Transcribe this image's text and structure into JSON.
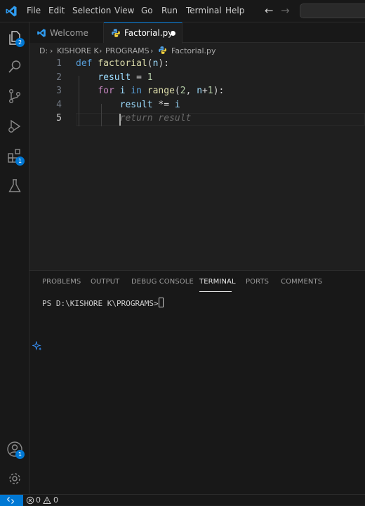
{
  "menu": [
    "File",
    "Edit",
    "Selection",
    "View",
    "Go",
    "Run",
    "Terminal",
    "Help"
  ],
  "activity": {
    "explorer_badge": "2",
    "extensions_badge": "1",
    "accounts_badge": "1"
  },
  "tabs": [
    {
      "label": "Welcome"
    },
    {
      "label": "Factorial.py",
      "modified": true
    }
  ],
  "breadcrumb": {
    "drive": "D:",
    "folder1": "KISHORE K",
    "folder2": "PROGRAMS",
    "file": "Factorial.py"
  },
  "editor": {
    "lines": [
      {
        "num": "1",
        "tokens": [
          [
            "kw",
            "def "
          ],
          [
            "fn",
            "factorial"
          ],
          [
            "txt",
            "("
          ],
          [
            "var",
            "n"
          ],
          [
            "txt",
            "):"
          ]
        ]
      },
      {
        "num": "2",
        "tokens": [
          [
            "txt",
            "    "
          ],
          [
            "var",
            "result"
          ],
          [
            "txt",
            " = "
          ],
          [
            "num",
            "1"
          ]
        ]
      },
      {
        "num": "3",
        "tokens": [
          [
            "txt",
            "    "
          ],
          [
            "kw2",
            "for "
          ],
          [
            "var",
            "i"
          ],
          [
            "kw",
            " in "
          ],
          [
            "fn",
            "range"
          ],
          [
            "txt",
            "("
          ],
          [
            "num",
            "2"
          ],
          [
            "txt",
            ", "
          ],
          [
            "var",
            "n"
          ],
          [
            "txt",
            "+"
          ],
          [
            "num",
            "1"
          ],
          [
            "txt",
            "):"
          ]
        ]
      },
      {
        "num": "4",
        "tokens": [
          [
            "txt",
            "        "
          ],
          [
            "var",
            "result"
          ],
          [
            "txt",
            " *= "
          ],
          [
            "var",
            "i"
          ]
        ]
      },
      {
        "num": "5",
        "tokens": [
          [
            "txt",
            "        "
          ],
          [
            "ghost",
            "return result"
          ]
        ]
      }
    ]
  },
  "panel": {
    "tabs": [
      "PROBLEMS",
      "OUTPUT",
      "DEBUG CONSOLE",
      "TERMINAL",
      "PORTS",
      "COMMENTS"
    ],
    "active_tab": "TERMINAL",
    "terminal_prompt": "PS D:\\KISHORE K\\PROGRAMS> "
  },
  "status": {
    "errors": "0",
    "warnings": "0"
  },
  "colors": {
    "accent": "#0078d4",
    "keyword": "#569cd6",
    "control": "#c586c0",
    "function": "#dcdcaa",
    "variable": "#9cdcfe",
    "number": "#b5cea8"
  }
}
